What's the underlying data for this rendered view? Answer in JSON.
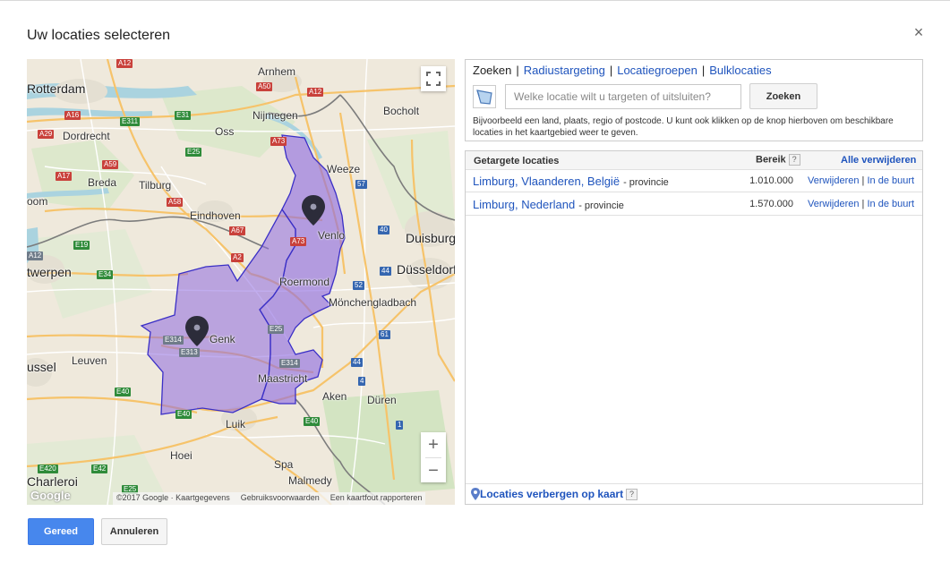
{
  "dialog": {
    "title": "Uw locaties selecteren",
    "close_icon": "×"
  },
  "map": {
    "cities": {
      "rotterdam": "Rotterdam",
      "arnhem": "Arnhem",
      "nijmegen": "Nijmegen",
      "bocholt": "Bocholt",
      "dordrecht": "Dordrecht",
      "oss": "Oss",
      "breda": "Breda",
      "tilburg": "Tilburg",
      "weeze": "Weeze",
      "oom": "oom",
      "eindhoven": "Eindhoven",
      "venlo": "Venlo",
      "duisburg": "Duisburg",
      "twerpen": "twerpen",
      "dusseldorf": "Düsseldorf",
      "roermond": "Roermond",
      "monchengladbach": "Mönchengladbach",
      "genk": "Genk",
      "ussel": "ussel",
      "leuven": "Leuven",
      "maastricht": "Maastricht",
      "aken": "Aken",
      "duren": "Düren",
      "luik": "Luik",
      "hoei": "Hoei",
      "spa": "Spa",
      "charleroi": "Charleroi",
      "malmedy": "Malmedy"
    },
    "roads": {
      "a12_top": "A12",
      "a50": "A50",
      "a12": "A12",
      "a16": "A16",
      "e311": "E311",
      "e31": "E31",
      "a29": "A29",
      "a73_top": "A73",
      "a59": "A59",
      "e25_top": "E25",
      "a17": "A17",
      "a58": "A58",
      "n57": "57",
      "a67": "A67",
      "a73": "A73",
      "e19": "E19",
      "a2": "A2",
      "a12_left": "A12",
      "n40": "40",
      "e34": "E34",
      "n44": "44",
      "n52": "52",
      "e314_genk": "E314",
      "e313": "E313",
      "e25": "E25",
      "e314": "E314",
      "n61": "61",
      "n44b": "44",
      "n4": "4",
      "e40_left": "E40",
      "e40_bottom": "E40",
      "e40_right": "E40",
      "n1": "1",
      "e420": "E420",
      "e42": "E42",
      "e25_bottom": "E25"
    },
    "zoom_in": "+",
    "zoom_out": "−",
    "attribution": {
      "copyright": "©2017 Google · Kaartgegevens",
      "terms": "Gebruiksvoorwaarden",
      "report": "Een kaartfout rapporteren"
    },
    "google_logo": "Google",
    "colors": {
      "selected_region": "#8e6ae0",
      "selected_outline": "#3a2fc6",
      "land": "#efe9dc",
      "water": "#aad3df"
    }
  },
  "search": {
    "tabs": [
      {
        "label": "Zoeken"
      },
      {
        "label": "Radiustargeting"
      },
      {
        "label": "Locatiegroepen"
      },
      {
        "label": "Bulklocaties"
      }
    ],
    "tab_separator": "|",
    "placeholder": "Welke locatie wilt u targeten of uitsluiten?",
    "button": "Zoeken",
    "helper": "Bijvoorbeeld een land, plaats, regio of postcode. U kunt ook klikken op de knop hierboven om beschikbare locaties in het kaartgebied weer te geven."
  },
  "results": {
    "header": {
      "locations": "Getargete locaties",
      "reach": "Bereik",
      "help": "?",
      "remove_all": "Alle verwijderen"
    },
    "rows": [
      {
        "name": "Limburg, Vlaanderen, België",
        "type": "- provincie",
        "reach": "1.010.000",
        "remove": "Verwijderen",
        "sep": "|",
        "nearby": "In de buurt"
      },
      {
        "name": "Limburg, Nederland",
        "type": "- provincie",
        "reach": "1.570.000",
        "remove": "Verwijderen",
        "sep": "|",
        "nearby": "In de buurt"
      }
    ],
    "footer": {
      "label": "Locaties verbergen op kaart",
      "help": "?"
    }
  },
  "actions": {
    "done": "Gereed",
    "cancel": "Annuleren"
  },
  "colors": {
    "primary_button": "#4787ed",
    "link": "#1f54bd"
  }
}
